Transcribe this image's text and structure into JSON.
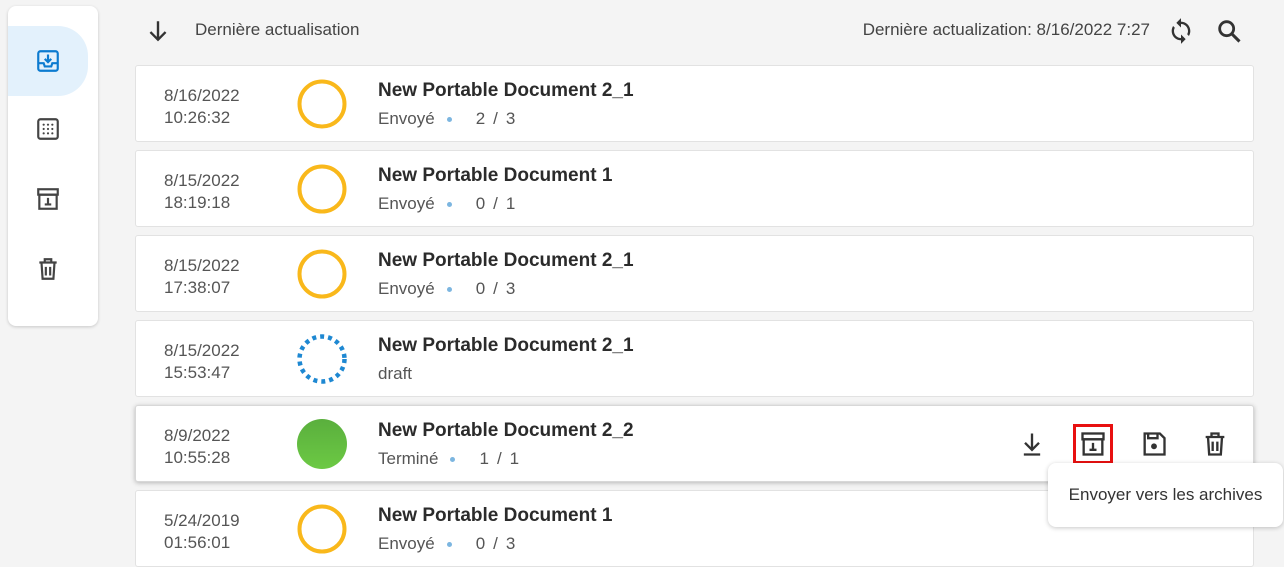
{
  "colors": {
    "accent": "#0c7bd0",
    "pending": "#f9b81b",
    "done": "#5dbe3b",
    "draft": "#1e88d2",
    "highlight": "#e81010"
  },
  "sidebar": {
    "items": [
      {
        "icon": "inbox-download-icon",
        "active": true
      },
      {
        "icon": "grid-dots-icon",
        "active": false
      },
      {
        "icon": "archive-icon",
        "active": false
      },
      {
        "icon": "trash-icon",
        "active": false
      }
    ]
  },
  "toolbar": {
    "sort_label": "Dernière actualisation",
    "refresh_label": "Dernière actualization:  8/16/2022 7:27"
  },
  "rows": [
    {
      "date": "8/16/2022",
      "time": "10:26:32",
      "title": "New Portable Document 2_1",
      "status": "Envoyé",
      "done": "2",
      "total": "3",
      "state": "pending"
    },
    {
      "date": "8/15/2022",
      "time": "18:19:18",
      "title": "New Portable Document 1",
      "status": "Envoyé",
      "done": "0",
      "total": "1",
      "state": "pending"
    },
    {
      "date": "8/15/2022",
      "time": "17:38:07",
      "title": "New Portable Document 2_1",
      "status": "Envoyé",
      "done": "0",
      "total": "3",
      "state": "pending"
    },
    {
      "date": "8/15/2022",
      "time": "15:53:47",
      "title": "New Portable Document 2_1",
      "status": "draft",
      "state": "draft"
    },
    {
      "date": "8/9/2022",
      "time": "10:55:28",
      "title": "New Portable Document 2_2",
      "status": "Terminé",
      "done": "1",
      "total": "1",
      "state": "done"
    },
    {
      "date": "5/24/2019",
      "time": "01:56:01",
      "title": "New Portable Document 1",
      "status": "Envoyé",
      "done": "0",
      "total": "3",
      "state": "pending"
    }
  ],
  "tooltip": {
    "text": "Envoyer vers les archives"
  }
}
